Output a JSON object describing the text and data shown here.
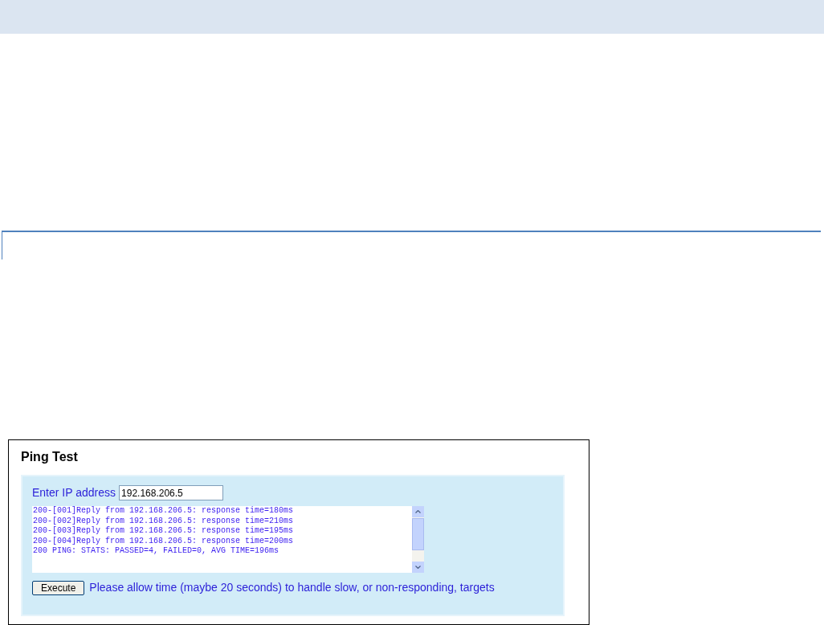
{
  "panel": {
    "title": "Ping Test"
  },
  "form": {
    "label": "Enter IP address",
    "value": "192.168.206.5"
  },
  "output": {
    "lines": [
      "200-[001]Reply from 192.168.206.5: response time=180ms",
      "200-[002]Reply from 192.168.206.5: response time=210ms",
      "200-[003]Reply from 192.168.206.5: response time=195ms",
      "200-[004]Reply from 192.168.206.5: response time=200ms",
      "200 PING: STATS: PASSED=4, FAILED=0, AVG TIME=196ms"
    ]
  },
  "execute_button": {
    "label": "Execute"
  },
  "note": "Please allow time (maybe 20 seconds) to handle slow, or non-responding, targets"
}
